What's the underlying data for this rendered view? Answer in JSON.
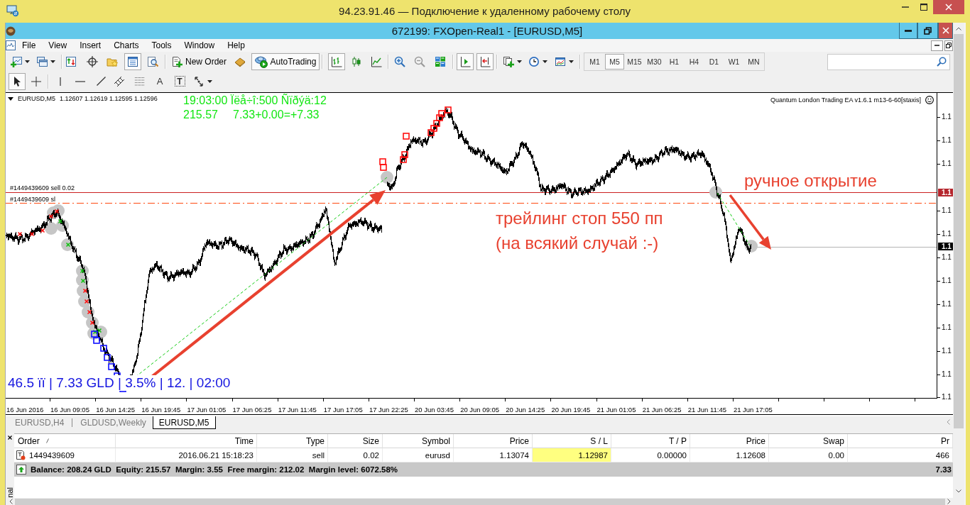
{
  "remote_window": {
    "title": "94.23.91.46 — Подключение к удаленному рабочему столу"
  },
  "app_window": {
    "title": "672199: FXOpen-Real1 - [EURUSD,M5]"
  },
  "menu": [
    "File",
    "View",
    "Insert",
    "Charts",
    "Tools",
    "Window",
    "Help"
  ],
  "main_toolbar": {
    "items": [
      {
        "kind": "dropdown",
        "pressed": false
      },
      {
        "kind": "dropdown",
        "pressed": false
      },
      {
        "kind": "icon",
        "pressed": false
      },
      {
        "kind": "icon",
        "pressed": false
      },
      {
        "kind": "icon",
        "pressed": false
      },
      {
        "kind": "icon",
        "pressed": true
      },
      {
        "kind": "icon",
        "pressed": false
      },
      {
        "kind": "labeled",
        "label": "New Order",
        "pressed": false
      },
      {
        "kind": "icon",
        "pressed": false
      },
      {
        "kind": "labeled",
        "label": "AutoTrading",
        "pressed": true
      },
      {
        "kind": "icon",
        "pressed": true
      },
      {
        "kind": "icon",
        "pressed": false
      },
      {
        "kind": "icon",
        "pressed": false
      },
      {
        "kind": "icon",
        "pressed": false
      },
      {
        "kind": "icon",
        "pressed": false
      },
      {
        "kind": "icon",
        "pressed": false
      },
      {
        "kind": "icon",
        "pressed": true
      },
      {
        "kind": "icon",
        "pressed": true
      },
      {
        "kind": "dropdown",
        "pressed": false
      },
      {
        "kind": "dropdown",
        "pressed": false
      },
      {
        "kind": "dropdown",
        "pressed": false
      }
    ],
    "timeframes": [
      {
        "label": "M1",
        "selected": false
      },
      {
        "label": "M5",
        "selected": true
      },
      {
        "label": "M15",
        "selected": false
      },
      {
        "label": "M30",
        "selected": false
      },
      {
        "label": "H1",
        "selected": false
      },
      {
        "label": "H4",
        "selected": false
      },
      {
        "label": "D1",
        "selected": false
      },
      {
        "label": "W1",
        "selected": false
      },
      {
        "label": "MN",
        "selected": false
      }
    ]
  },
  "drawing_toolbar": {
    "items": [
      {
        "kind": "icon",
        "pressed": true
      },
      {
        "kind": "icon",
        "pressed": false
      },
      {
        "kind": "icon",
        "pressed": false
      },
      {
        "kind": "icon",
        "pressed": false
      },
      {
        "kind": "icon",
        "pressed": false
      },
      {
        "kind": "icon",
        "pressed": false
      },
      {
        "kind": "icon",
        "pressed": false
      },
      {
        "kind": "letter",
        "label": "A",
        "pressed": false
      },
      {
        "kind": "framed_letter",
        "label": "T",
        "pressed": false
      },
      {
        "kind": "dropdown",
        "pressed": false
      }
    ]
  },
  "chart": {
    "symbol": "EURUSD,M5",
    "quote": "1.12607 1.12619 1.12595 1.12596",
    "expert": "Quantum London Trading EA v1.6.1 m13-6-60[staxis]",
    "info": {
      "line_1": "19:03:00 Ïëå÷î:500 Ñïðýä:12",
      "line_2": [
        "215.57",
        "7.33+0.00=+7.33"
      ]
    },
    "stats": "46.5 ïï | 7.33 GLD | 3.5% | 12. | 02:00",
    "order_lines": [
      {
        "kind": "entry",
        "label": "#1449439609 sell 0.02"
      },
      {
        "kind": "stop_loss",
        "label": "#1449439609 sl"
      }
    ],
    "notes": [
      "трейлинг стоп 550 пп",
      "(на всякий случай :-)",
      "ручное открытие"
    ],
    "price_labels": [
      "1.1",
      "1.1",
      "1.1",
      "1.1",
      "1.1",
      "1.1",
      "1.1",
      "1.1",
      "1.1",
      "1.1",
      "1.1",
      "1.1"
    ],
    "price_markers": [
      {
        "kind": "entry",
        "text": "1.1"
      },
      {
        "kind": "bid",
        "text": "1.1"
      }
    ],
    "time_labels": [
      "16 Jun 2016",
      "16 Jun 09:05",
      "16 Jun 14:25",
      "16 Jun 19:45",
      "17 Jun 01:05",
      "17 Jun 06:25",
      "17 Jun 11:45",
      "17 Jun 17:05",
      "17 Jun 22:25",
      "20 Jun 03:45",
      "20 Jun 09:05",
      "20 Jun 14:25",
      "20 Jun 19:45",
      "21 Jun 01:05",
      "21 Jun 06:25",
      "21 Jun 11:45",
      "21 Jun 17:05"
    ]
  },
  "chart_tabs": [
    {
      "label": "EURUSD,H4",
      "selected": false
    },
    {
      "label": "GLDUSD,Weekly",
      "selected": false
    },
    {
      "label": "EURUSD,M5",
      "selected": true
    }
  ],
  "terminal": {
    "side_label": "nal",
    "columns": [
      {
        "label": "Order",
        "sorted": true
      },
      {
        "label": "Time",
        "sorted": false
      },
      {
        "label": "Type",
        "sorted": false
      },
      {
        "label": "Size",
        "sorted": false
      },
      {
        "label": "Symbol",
        "sorted": false
      },
      {
        "label": "Price",
        "sorted": false
      },
      {
        "label": "S / L",
        "sorted": false
      },
      {
        "label": "T / P",
        "sorted": false
      },
      {
        "label": "Price",
        "sorted": false
      },
      {
        "label": "Swap",
        "sorted": false
      },
      {
        "label": "Pr",
        "sorted": false
      }
    ],
    "rows": [
      {
        "cells": [
          {
            "text": "1449439609",
            "highlighted": false
          },
          {
            "text": "2016.06.21 15:18:23",
            "highlighted": false
          },
          {
            "text": "sell",
            "highlighted": false
          },
          {
            "text": "0.02",
            "highlighted": false
          },
          {
            "text": "eurusd",
            "highlighted": false
          },
          {
            "text": "1.13074",
            "highlighted": false
          },
          {
            "text": "1.12987",
            "highlighted": true
          },
          {
            "text": "0.00000",
            "highlighted": false
          },
          {
            "text": "1.12608",
            "highlighted": false
          },
          {
            "text": "0.00",
            "highlighted": false
          },
          {
            "text": "466",
            "highlighted": false
          }
        ]
      }
    ],
    "summary": {
      "text": "Balance: 208.24 GLD  Equity: 215.57  Margin: 3.55  Free margin: 212.02  Margin level: 6072.58%",
      "total": "7.33"
    }
  }
}
